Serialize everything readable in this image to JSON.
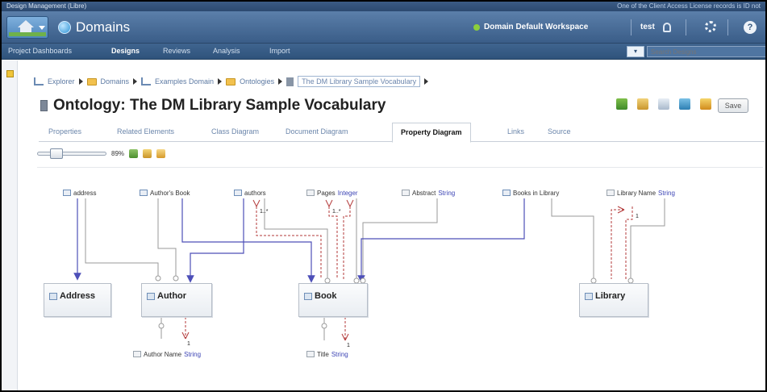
{
  "window": {
    "title": "Design Management (Libre)",
    "license_notice": "One of the Client Access License records is ID not"
  },
  "app": {
    "title": "Domains",
    "workspace": "Domain Default Workspace",
    "user": "test"
  },
  "menu": {
    "items": [
      "Project Dashboards",
      "Designs",
      "Reviews",
      "Analysis",
      "Import"
    ],
    "active": "Designs",
    "search_placeholder": "Search Designs"
  },
  "breadcrumb": {
    "items": [
      "Explorer",
      "Domains",
      "Examples Domain",
      "Ontologies",
      "The DM Library Sample Vocabulary"
    ]
  },
  "page": {
    "title": "Ontology: The DM Library Sample Vocabulary",
    "save_label": "Save"
  },
  "tabs": [
    "Properties",
    "Related Elements",
    "Class Diagram",
    "Document Diagram",
    "Property Diagram",
    "Links",
    "Source"
  ],
  "active_tab": "Property Diagram",
  "zoom": {
    "label": "89%",
    "value_percent": 89
  },
  "diagram": {
    "properties": [
      {
        "name": "address",
        "type": "",
        "kind": "object"
      },
      {
        "name": "Author's Book",
        "type": "",
        "kind": "object"
      },
      {
        "name": "authors",
        "type": "",
        "kind": "object"
      },
      {
        "name": "Pages",
        "type": "Integer",
        "kind": "datatype"
      },
      {
        "name": "Abstract",
        "type": "String",
        "kind": "datatype"
      },
      {
        "name": "Books in Library",
        "type": "",
        "kind": "object"
      },
      {
        "name": "Library Name",
        "type": "String",
        "kind": "datatype"
      },
      {
        "name": "Author Name",
        "type": "String",
        "kind": "datatype"
      },
      {
        "name": "Title",
        "type": "String",
        "kind": "datatype"
      }
    ],
    "classes": [
      "Address",
      "Author",
      "Book",
      "Library"
    ],
    "multiplicities": [
      "1..*",
      "1..*",
      "1",
      "1",
      "1"
    ]
  },
  "colors": {
    "header": "#3a5d88",
    "object_link": "#4d4fb8",
    "range_link": "#b33a3a",
    "generic_link": "#9a9a9a",
    "type_text": "#3d45b5"
  }
}
